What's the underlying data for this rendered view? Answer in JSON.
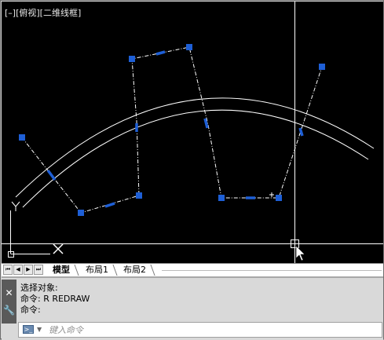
{
  "viewport": {
    "view_label": "[–][俯视][二维线框]",
    "background": "#000000",
    "grip_color": "#1e5fd6",
    "ucs_y_label": "Y",
    "ucs_x_label": "X"
  },
  "tabs": {
    "nav": [
      "first-tab",
      "previous-tab",
      "next-tab",
      "last-tab"
    ],
    "items": [
      {
        "label": "模型",
        "active": true
      },
      {
        "label": "布局1",
        "active": false
      },
      {
        "label": "布局2",
        "active": false
      }
    ]
  },
  "command": {
    "history": [
      "选择对象:",
      "命令: R REDRAW",
      "命令:"
    ],
    "placeholder": "键入命令",
    "close_icon": "close-icon",
    "settings_icon": "wrench-icon"
  }
}
